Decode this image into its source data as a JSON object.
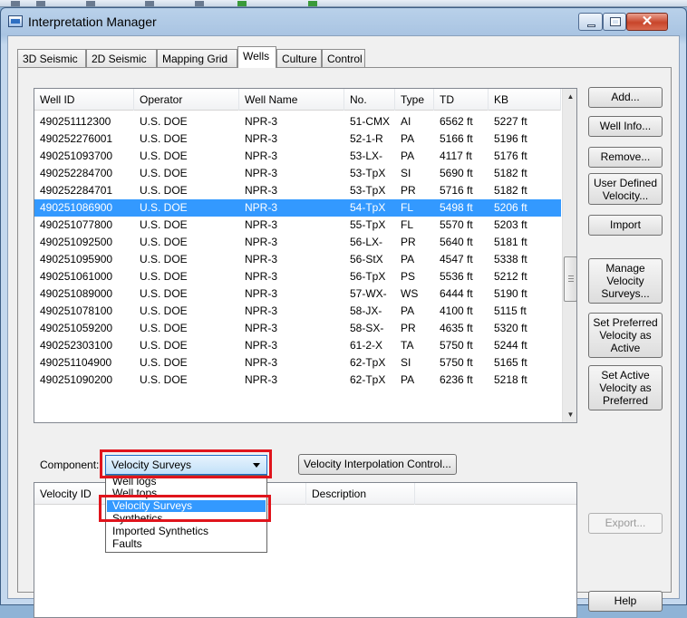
{
  "window": {
    "title": "Interpretation Manager",
    "close_glyph": "✕"
  },
  "tabs": [
    {
      "label": "3D Seismic",
      "active": false
    },
    {
      "label": "2D Seismic",
      "active": false
    },
    {
      "label": "Mapping Grid",
      "active": false
    },
    {
      "label": "Wells",
      "active": true
    },
    {
      "label": "Culture",
      "active": false
    },
    {
      "label": "Control",
      "active": false
    }
  ],
  "wells_table": {
    "columns": [
      "Well ID",
      "Operator",
      "Well Name",
      "No.",
      "Type",
      "TD",
      "KB"
    ],
    "selected_index": 6,
    "rows": [
      [
        "490251112300",
        "U.S. DOE",
        "NPR-3",
        "51-CMX",
        "AI",
        "6562 ft",
        "5227 ft"
      ],
      [
        "490252276001",
        "U.S. DOE",
        "NPR-3",
        "52-1-R",
        "PA",
        "5166 ft",
        "5196 ft"
      ],
      [
        "490251093700",
        "U.S. DOE",
        "NPR-3",
        "53-LX-",
        "PA",
        "4117 ft",
        "5176 ft"
      ],
      [
        "490252284700",
        "U.S. DOE",
        "NPR-3",
        "53-TpX",
        "SI",
        "5690 ft",
        "5182 ft"
      ],
      [
        "490252284701",
        "U.S. DOE",
        "NPR-3",
        "53-TpX",
        "PR",
        "5716 ft",
        "5182 ft"
      ],
      [
        "490251086900",
        "U.S. DOE",
        "NPR-3",
        "54-TpX",
        "FL",
        "5498 ft",
        "5206 ft"
      ],
      [
        "490251077800",
        "U.S. DOE",
        "NPR-3",
        "55-TpX",
        "FL",
        "5570 ft",
        "5203 ft"
      ],
      [
        "490251092500",
        "U.S. DOE",
        "NPR-3",
        "56-LX-",
        "PR",
        "5640 ft",
        "5181 ft"
      ],
      [
        "490251095900",
        "U.S. DOE",
        "NPR-3",
        "56-StX",
        "PA",
        "4547 ft",
        "5338 ft"
      ],
      [
        "490251061000",
        "U.S. DOE",
        "NPR-3",
        "56-TpX",
        "PS",
        "5536 ft",
        "5212 ft"
      ],
      [
        "490251089000",
        "U.S. DOE",
        "NPR-3",
        "57-WX-",
        "WS",
        "6444 ft",
        "5190 ft"
      ],
      [
        "490251078100",
        "U.S. DOE",
        "NPR-3",
        "58-JX-",
        "PA",
        "4100 ft",
        "5115 ft"
      ],
      [
        "490251059200",
        "U.S. DOE",
        "NPR-3",
        "58-SX-",
        "PR",
        "4635 ft",
        "5320 ft"
      ],
      [
        "490252303100",
        "U.S. DOE",
        "NPR-3",
        "61-2-X",
        "TA",
        "5750 ft",
        "5244 ft"
      ],
      [
        "490251104900",
        "U.S. DOE",
        "NPR-3",
        "62-TpX",
        "SI",
        "5750 ft",
        "5165 ft"
      ],
      [
        "490251090200",
        "U.S. DOE",
        "NPR-3",
        "62-TpX",
        "PA",
        "6236 ft",
        "5218 ft"
      ]
    ]
  },
  "scrollbar": {
    "up_glyph": "▲",
    "down_glyph": "▼"
  },
  "side_buttons": {
    "add": "Add...",
    "well_info": "Well Info...",
    "remove": "Remove...",
    "user_defined_velocity": [
      "User Defined",
      "Velocity..."
    ],
    "import": "Import",
    "manage_velocity_surveys": [
      "Manage",
      "Velocity",
      "Surveys..."
    ],
    "set_preferred_as_active": [
      "Set Preferred",
      "Velocity as",
      "Active"
    ],
    "set_active_as_preferred": [
      "Set Active",
      "Velocity as",
      "Preferred"
    ],
    "export": "Export...",
    "help": "Help"
  },
  "component": {
    "label": "Component:",
    "selected": "Velocity Surveys",
    "options": [
      "Well logs",
      "Well tops",
      "Velocity Surveys",
      "Synthetics",
      "Imported Synthetics",
      "Faults"
    ],
    "highlighted_option": "Velocity Surveys"
  },
  "velocity_interpolation_button": "Velocity Interpolation Control...",
  "survey_table": {
    "columns": [
      "Velocity ID",
      "Description"
    ]
  },
  "colors": {
    "selection": "#3399ff",
    "highlight_box": "#e0141c"
  }
}
